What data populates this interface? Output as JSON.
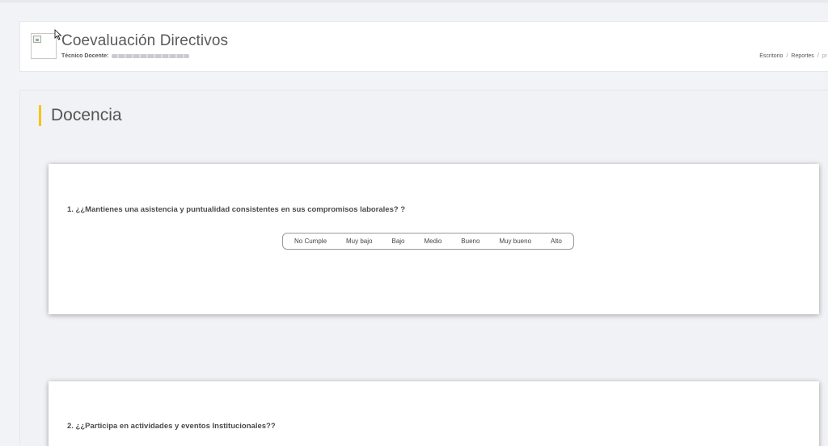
{
  "header": {
    "title": "Coevaluación Directivos",
    "subtitle_label": "Técnico Docente:"
  },
  "breadcrumb": {
    "items": [
      "Escritorio",
      "Reportes",
      "pr"
    ]
  },
  "section": {
    "title": "Docencia",
    "accent_color": "#f5c518"
  },
  "questions": [
    {
      "text": "1. ¿¿Mantienes una asistencia y puntualidad consistentes en sus compromisos laborales? ?",
      "options": [
        "No Cumple",
        "Muy bajo",
        "Bajo",
        "Medio",
        "Bueno",
        "Muy bueno",
        "Alto"
      ]
    },
    {
      "text": "2. ¿¿Participa en actividades y eventos Institucionales??"
    }
  ]
}
